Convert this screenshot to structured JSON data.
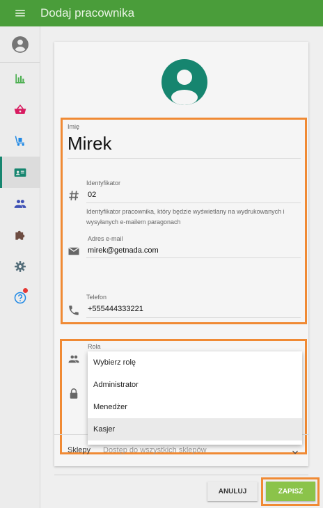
{
  "header": {
    "title": "Dodaj pracownika"
  },
  "icons": {
    "menu": "menu-icon",
    "account": "account-circle-icon",
    "stats": "bar-chart-icon",
    "basket": "basket-icon",
    "delivery": "hand-truck-icon",
    "employee_card": "badge-icon",
    "people": "people-icon",
    "extensions": "puzzle-icon",
    "settings": "gear-icon",
    "help": "help-icon"
  },
  "colors": {
    "appbar": "#4a9d3a",
    "accent": "#16856f",
    "highlight": "#f08a34",
    "save": "#8bc34a"
  },
  "form": {
    "name_label": "Imię",
    "name_value": "Mirek",
    "id_label": "Identyfikator",
    "id_value": "02",
    "id_hint": "Identyfikator pracownika, który będzie wyświetlany na wydrukowanych i wysyłanych e-mailem paragonach",
    "email_label": "Adres e-mail",
    "email_value": "mirek@getnada.com",
    "phone_label": "Telefon",
    "phone_value": "+555444333221",
    "role_label": "Rola",
    "stores_label": "Sklepy",
    "stores_value": "Dostęp do wszystkich sklepów"
  },
  "role_dropdown": {
    "options": [
      "Wybierz rolę",
      "Administrator",
      "Menedżer",
      "Kasjer"
    ]
  },
  "actions": {
    "cancel": "ANULUJ",
    "save": "ZAPISZ"
  }
}
